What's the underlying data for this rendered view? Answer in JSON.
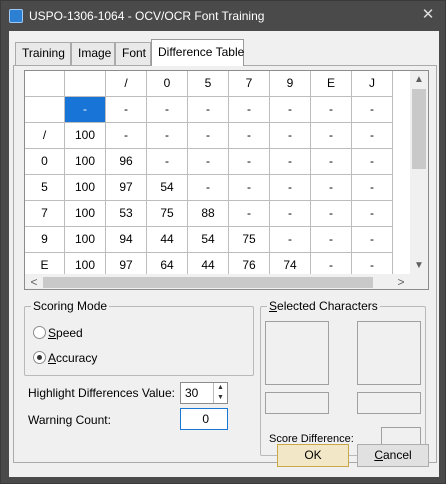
{
  "window": {
    "title": "USPO-1306-1064 - OCV/OCR Font Training",
    "close_glyph": "✕"
  },
  "tabs": [
    {
      "label": "Training"
    },
    {
      "label": "Image"
    },
    {
      "label": "Font"
    },
    {
      "label": "Difference Table"
    }
  ],
  "difference_table": {
    "columns": [
      "",
      "",
      "/",
      "0",
      "5",
      "7",
      "9",
      "E",
      "J"
    ],
    "rows": [
      [
        "",
        "-",
        "-",
        "-",
        "-",
        "-",
        "-",
        "-",
        "-"
      ],
      [
        "/",
        "100",
        "-",
        "-",
        "-",
        "-",
        "-",
        "-",
        "-"
      ],
      [
        "0",
        "100",
        "96",
        "-",
        "-",
        "-",
        "-",
        "-",
        "-"
      ],
      [
        "5",
        "100",
        "97",
        "54",
        "-",
        "-",
        "-",
        "-",
        "-"
      ],
      [
        "7",
        "100",
        "53",
        "75",
        "88",
        "-",
        "-",
        "-",
        "-"
      ],
      [
        "9",
        "100",
        "94",
        "44",
        "54",
        "75",
        "-",
        "-",
        "-"
      ],
      [
        "E",
        "100",
        "97",
        "64",
        "44",
        "76",
        "74",
        "-",
        "-"
      ]
    ]
  },
  "scrollbar": {
    "up": "▲",
    "down": "▼",
    "left": "<",
    "right": ">"
  },
  "scoring_mode": {
    "legend_underlined": "",
    "legend": "Scoring Mode",
    "options": [
      {
        "underlined": "S",
        "rest": "peed",
        "selected": false
      },
      {
        "underlined": "A",
        "rest": "ccuracy",
        "selected": true
      }
    ]
  },
  "highlight": {
    "label": "Highlight Differences Value:",
    "value": "30",
    "up": "▲",
    "down": "▼"
  },
  "warning": {
    "label": "Warning Count:",
    "value": "0"
  },
  "selected_characters": {
    "legend_underlined": "S",
    "legend_rest": "elected Characters"
  },
  "score_difference": {
    "label": "Score Difference:"
  },
  "buttons": {
    "ok": "OK",
    "cancel_underlined": "C",
    "cancel_rest": "ancel"
  },
  "colors": {
    "selection": "#1874d6",
    "title_bar": "#4a4a4a",
    "dialog_bg": "#f0f0f0"
  }
}
